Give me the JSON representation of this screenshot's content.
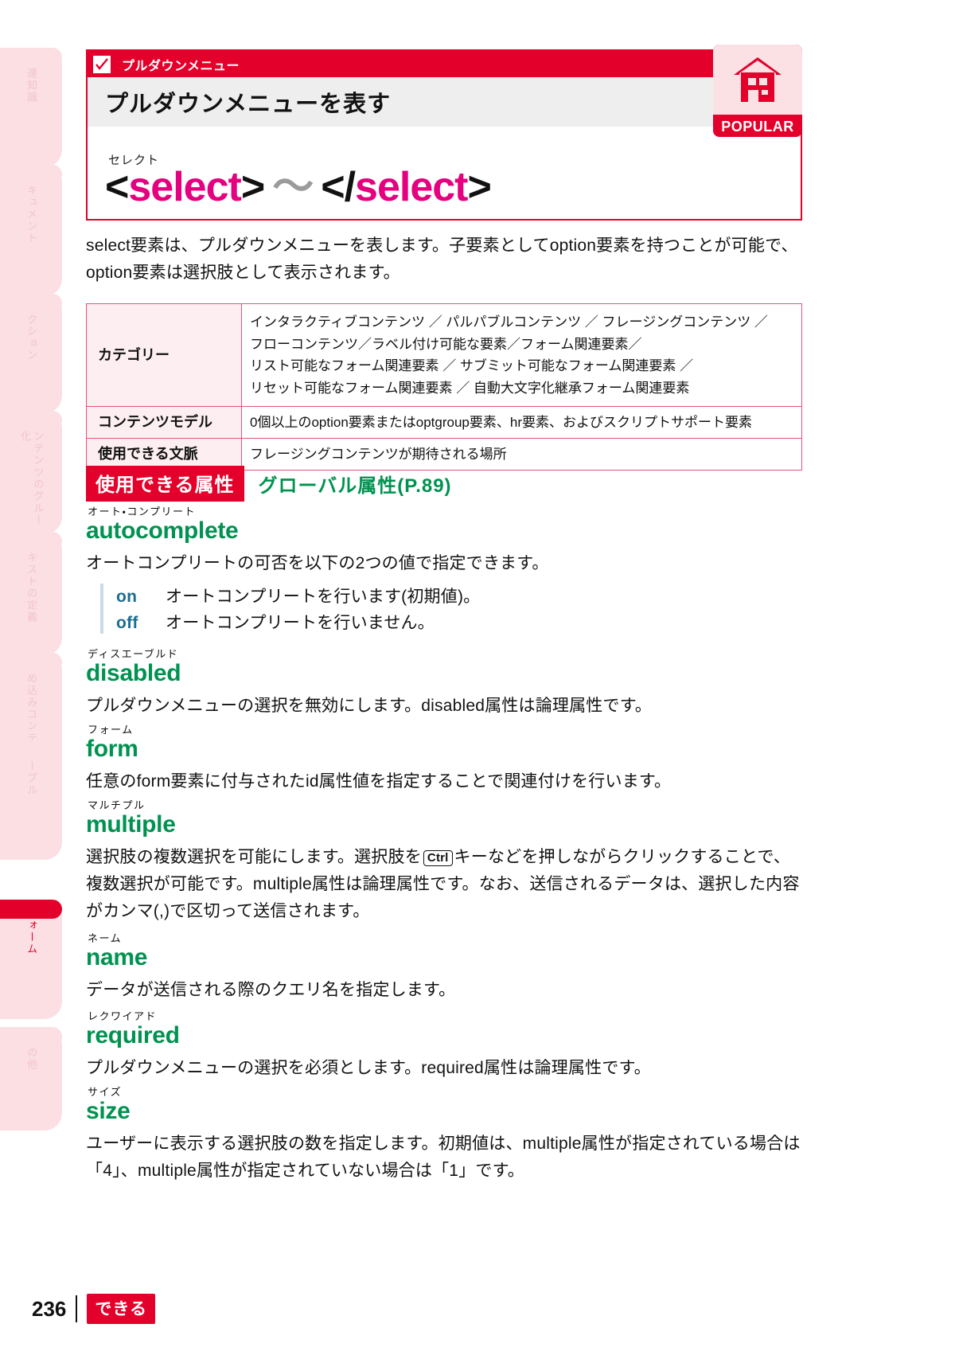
{
  "sidebar": {
    "items": [
      {
        "label": "関連知識",
        "active": false
      },
      {
        "label": "ドキュメント",
        "active": false
      },
      {
        "label": "セクション",
        "active": false
      },
      {
        "label": "コンテンツのグループ化",
        "active": false
      },
      {
        "label": "テキストの定義",
        "active": false
      },
      {
        "label": "埋め込みコンテンツ",
        "active": false
      },
      {
        "label": "テーブル",
        "active": false
      },
      {
        "label": "フォーム",
        "active": true
      },
      {
        "label": "その他",
        "active": false
      }
    ]
  },
  "header": {
    "category_label": "プルダウンメニュー",
    "title": "プルダウンメニューを表す",
    "element_furigana": "セレクト",
    "element_open": "<select>",
    "element_tilde": "〜",
    "element_close": "</select>",
    "badge_label": "POPULAR",
    "badge_icon": "house-icon",
    "check_icon": "check-box-icon"
  },
  "intro": "select要素は、プルダウンメニューを表します。子要素としてoption要素を持つことが可能で、option要素は選択肢として表示されます。",
  "spec_table": {
    "rows": [
      {
        "key": "カテゴリー",
        "value_lines": [
          "インタラクティブコンテンツ ／ パルパブルコンテンツ ／ フレージングコンテンツ ／",
          "フローコンテンツ／ラベル付け可能な要素／フォーム関連要素／",
          "リスト可能なフォーム関連要素 ／ サブミット可能なフォーム関連要素 ／",
          "リセット可能なフォーム関連要素 ／ 自動大文字化継承フォーム関連要素"
        ]
      },
      {
        "key": "コンテンツモデル",
        "value_lines": [
          "0個以上のoption要素またはoptgroup要素、hr要素、およびスクリプトサポート要素"
        ]
      },
      {
        "key": "使用できる文脈",
        "value_lines": [
          "フレージングコンテンツが期待される場所"
        ]
      }
    ]
  },
  "attributes_header": {
    "tag": "使用できる属性",
    "global": "グローバル属性(P.89)"
  },
  "attributes": [
    {
      "furigana": "オート・コンプリート",
      "name": "autocomplete",
      "desc": "オートコンプリートの可否を以下の2つの値で指定できます。",
      "values": [
        {
          "key": "on",
          "text": "オートコンプリートを行います(初期値)。"
        },
        {
          "key": "off",
          "text": "オートコンプリートを行いません。"
        }
      ]
    },
    {
      "furigana": "ディスエーブルド",
      "name": "disabled",
      "desc": "プルダウンメニューの選択を無効にします。disabled属性は論理属性です。",
      "values": []
    },
    {
      "furigana": "フォーム",
      "name": "form",
      "desc": "任意のform要素に付与されたid属性値を指定することで関連付けを行います。",
      "values": []
    },
    {
      "furigana": "マルチプル",
      "name": "multiple",
      "desc_parts": {
        "before": "選択肢の複数選択を可能にします。選択肢を",
        "kbd": "Ctrl",
        "after": "キーなどを押しながらクリックすることで、複数選択が可能です。multiple属性は論理属性です。なお、送信されるデータは、選択した内容がカンマ(,)で区切って送信されます。"
      },
      "values": []
    },
    {
      "furigana": "ネーム",
      "name": "name",
      "desc": "データが送信される際のクエリ名を指定します。",
      "values": []
    },
    {
      "furigana": "レクワイアド",
      "name": "required",
      "desc": "プルダウンメニューの選択を必須とします。required属性は論理属性です。",
      "values": []
    },
    {
      "furigana": "サイズ",
      "name": "size",
      "desc": "ユーザーに表示する選択肢の数を指定します。初期値は、multiple属性が指定されている場合は「4」、multiple属性が指定されていない場合は「1」です。",
      "values": []
    }
  ],
  "footer": {
    "page_number": "236",
    "brand": "できる"
  },
  "colors": {
    "brand_red": "#e3002b",
    "attr_green": "#009250",
    "magenta": "#e4007f",
    "value_blue": "#1b6d93"
  }
}
